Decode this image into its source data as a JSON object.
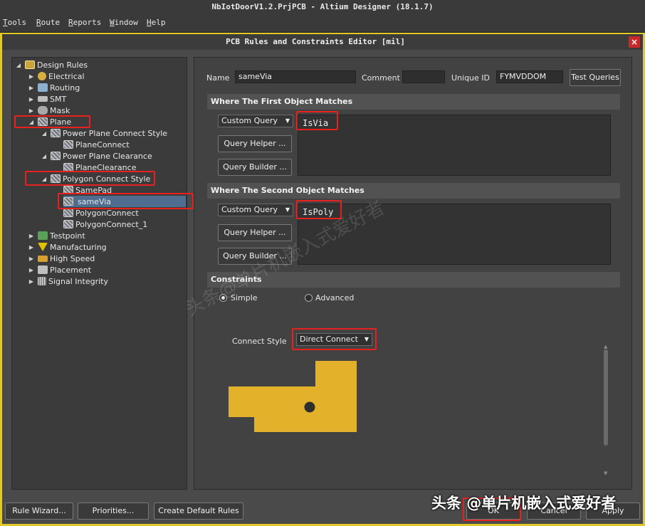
{
  "app": {
    "title": "NbIotDoorV1.2.PrjPCB - Altium Designer (18.1.7)"
  },
  "menu": [
    "Tools",
    "Route",
    "Reports",
    "Window",
    "Help"
  ],
  "dialog": {
    "title": "PCB Rules and Constraints Editor [mil]",
    "close": "×"
  },
  "tree": {
    "root": "Design Rules",
    "items": [
      "Electrical",
      "Routing",
      "SMT",
      "Mask",
      "Plane",
      "Power Plane Connect Style",
      "PlaneConnect",
      "Power Plane Clearance",
      "PlaneClearance",
      "Polygon Connect Style",
      "SamePad",
      "sameVia",
      "PolygonConnect",
      "PolygonConnect_1",
      "Testpoint",
      "Manufacturing",
      "High Speed",
      "Placement",
      "Signal Integrity"
    ],
    "expanded_arrow": "◢",
    "collapsed_arrow": "▶"
  },
  "rule": {
    "name_label": "Name",
    "name": "sameVia",
    "comment_label": "Comment",
    "comment": "",
    "unique_id_label": "Unique ID",
    "unique_id": "FYMVDDOM",
    "test_queries": "Test Queries"
  },
  "first_match": {
    "header": "Where The First Object Matches",
    "mode": "Custom Query",
    "helper": "Query Helper ...",
    "builder": "Query Builder ...",
    "query": "IsVia"
  },
  "second_match": {
    "header": "Where The Second Object Matches",
    "mode": "Custom Query",
    "helper": "Query Helper ...",
    "builder": "Query Builder ...",
    "query": "IsPoly"
  },
  "constraints": {
    "header": "Constraints",
    "simple": "Simple",
    "advanced": "Advanced",
    "connect_style_label": "Connect Style",
    "connect_style": "Direct Connect"
  },
  "bottom": {
    "rule_wizard": "Rule Wizard...",
    "priorities": "Priorities...",
    "create_default": "Create Default Rules",
    "ok": "OK",
    "cancel": "Cancel",
    "apply": "Apply"
  },
  "watermark": {
    "diagonal": "头条@单片机嵌入式爱好者",
    "bottom": "头条 @单片机嵌入式爱好者"
  },
  "colors": {
    "highlight": "#e8201e",
    "copper": "#e3b22a",
    "accent_border": "#e3c82a",
    "selection": "#4f6d8f"
  }
}
